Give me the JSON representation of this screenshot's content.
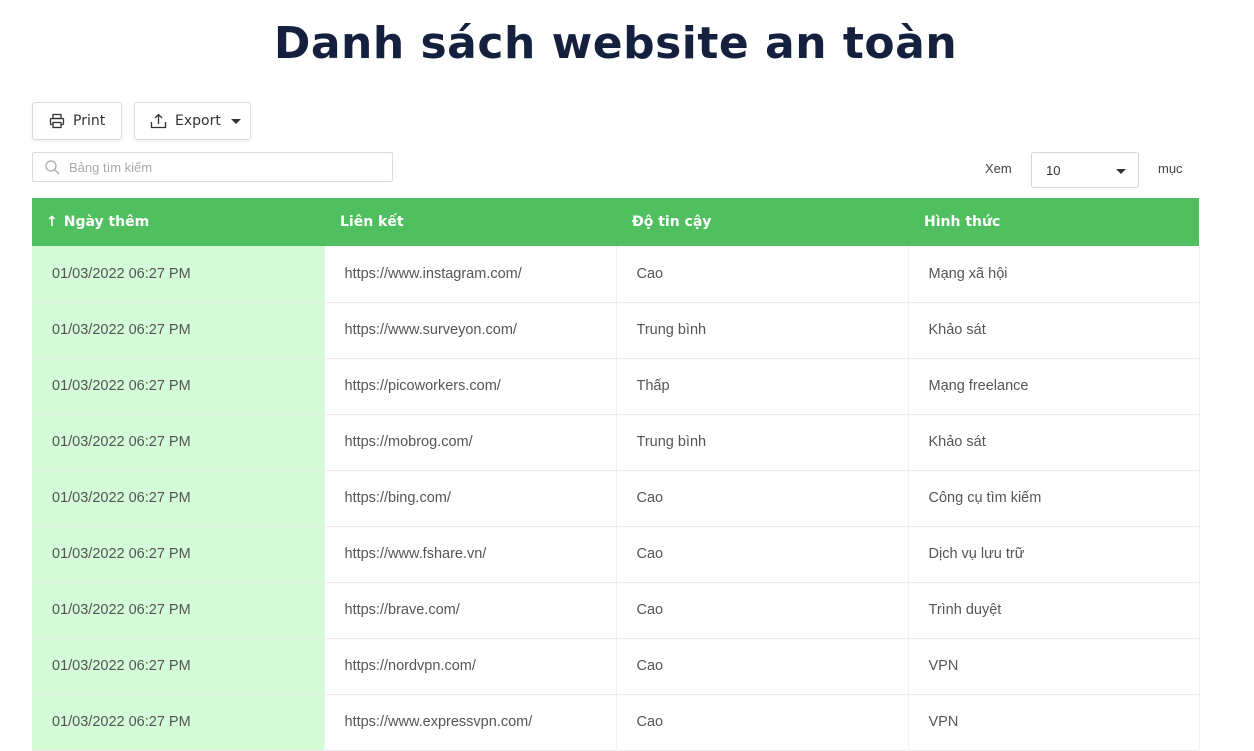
{
  "page": {
    "title": "Danh sách website an toàn"
  },
  "toolbar": {
    "print_label": "Print",
    "export_label": "Export"
  },
  "search": {
    "placeholder": "Bảng tìm kiếm"
  },
  "page_size": {
    "before_label": "Xem",
    "value": "10",
    "after_label": "mục"
  },
  "colors": {
    "header_bg": "#4fbf5f",
    "sorted_column_bg": "#d2fbd6",
    "title_color": "#15203f"
  },
  "table": {
    "sort_icon": "arrow-up-icon",
    "headers": [
      "Ngày thêm",
      "Liên kết",
      "Độ tin cậy",
      "Hình thức"
    ],
    "rows": [
      [
        "01/03/2022 06:27 PM",
        "https://www.instagram.com/",
        "Cao",
        "Mạng xã hội"
      ],
      [
        "01/03/2022 06:27 PM",
        "https://www.surveyon.com/",
        "Trung bình",
        "Khảo sát"
      ],
      [
        "01/03/2022 06:27 PM",
        "https://picoworkers.com/",
        "Thấp",
        "Mạng freelance"
      ],
      [
        "01/03/2022 06:27 PM",
        "https://mobrog.com/",
        "Trung bình",
        "Khảo sát"
      ],
      [
        "01/03/2022 06:27 PM",
        "https://bing.com/",
        "Cao",
        "Công cụ tìm kiếm"
      ],
      [
        "01/03/2022 06:27 PM",
        "https://www.fshare.vn/",
        "Cao",
        "Dịch vụ lưu trữ"
      ],
      [
        "01/03/2022 06:27 PM",
        "https://brave.com/",
        "Cao",
        "Trình duyệt"
      ],
      [
        "01/03/2022 06:27 PM",
        "https://nordvpn.com/",
        "Cao",
        "VPN"
      ],
      [
        "01/03/2022 06:27 PM",
        "https://www.expressvpn.com/",
        "Cao",
        "VPN"
      ]
    ]
  }
}
